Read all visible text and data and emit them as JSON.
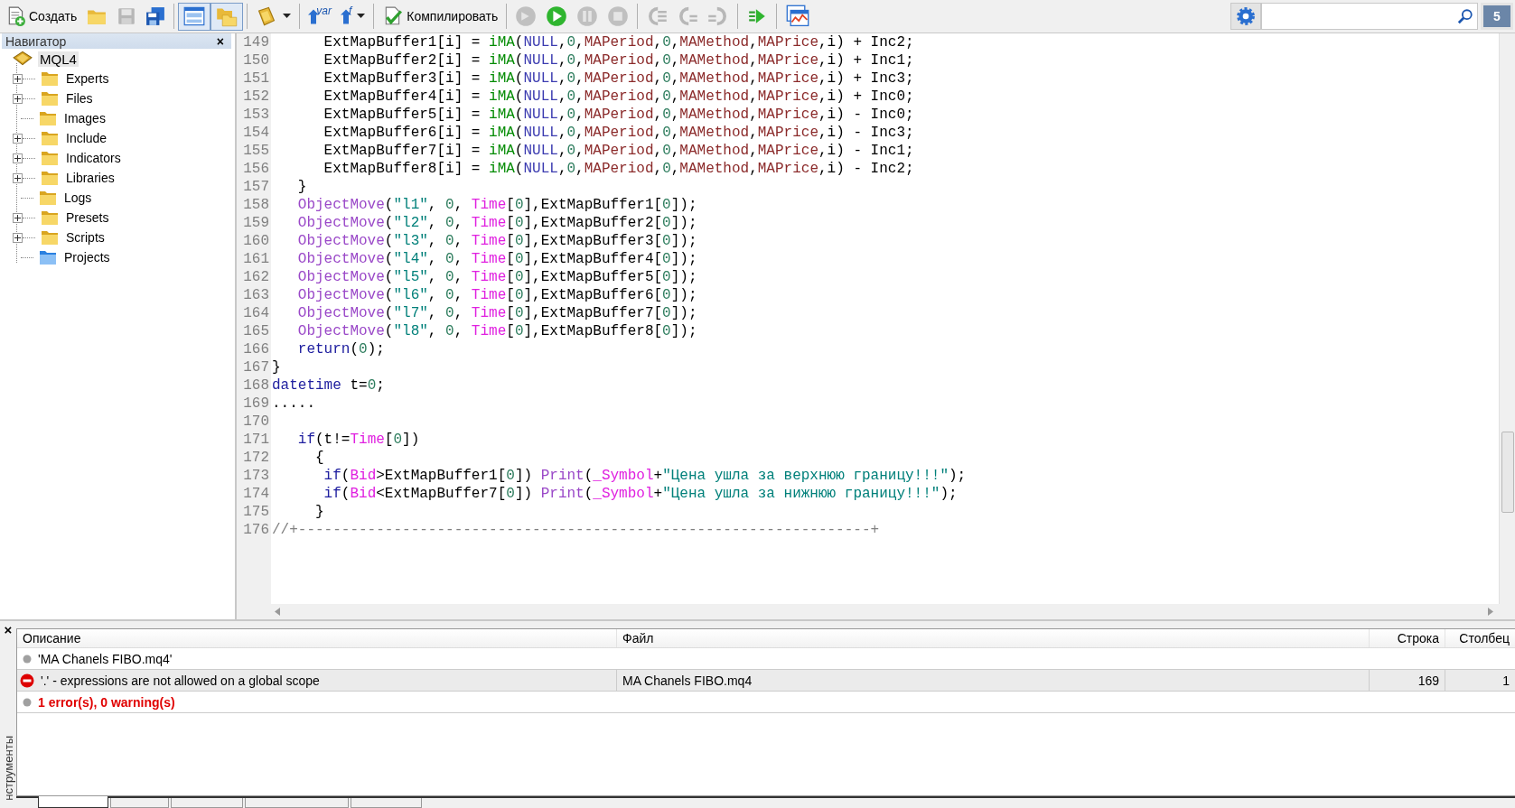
{
  "toolbar": {
    "items": [
      {
        "kind": "button",
        "label": "Создать",
        "pressed": false,
        "disabled": false
      },
      {
        "kind": "button",
        "pressed": false,
        "disabled": false
      },
      {
        "kind": "button",
        "pressed": false,
        "disabled": true
      },
      {
        "kind": "button",
        "pressed": false,
        "disabled": false
      },
      {
        "kind": "separator"
      },
      {
        "kind": "button",
        "pressed": true,
        "disabled": false
      },
      {
        "kind": "button",
        "pressed": true,
        "disabled": false
      },
      {
        "kind": "separator"
      },
      {
        "kind": "dropdown",
        "pressed": false,
        "disabled": false
      },
      {
        "kind": "separator"
      },
      {
        "kind": "button",
        "sup": "var",
        "pressed": false,
        "disabled": false
      },
      {
        "kind": "dropdown",
        "sup": "f",
        "pressed": false,
        "disabled": false
      },
      {
        "kind": "separator"
      },
      {
        "kind": "button",
        "label": "Компилировать",
        "pressed": false,
        "disabled": false
      },
      {
        "kind": "separator"
      },
      {
        "kind": "button",
        "pressed": false,
        "disabled": true
      },
      {
        "kind": "button",
        "pressed": false,
        "disabled": false
      },
      {
        "kind": "button",
        "pressed": false,
        "disabled": true
      },
      {
        "kind": "button",
        "pressed": false,
        "disabled": true
      },
      {
        "kind": "separator"
      },
      {
        "kind": "button",
        "pressed": false,
        "disabled": true
      },
      {
        "kind": "button",
        "pressed": false,
        "disabled": true
      },
      {
        "kind": "button",
        "pressed": false,
        "disabled": true
      },
      {
        "kind": "separator"
      },
      {
        "kind": "button",
        "pressed": false,
        "disabled": false
      },
      {
        "kind": "separator"
      },
      {
        "kind": "button",
        "pressed": false,
        "disabled": false
      }
    ],
    "messages_badge": "5"
  },
  "navigator": {
    "title": "Навигатор",
    "close": "×",
    "root": {
      "label": "MQL4",
      "selected": true,
      "children": [
        {
          "label": "Experts",
          "kind": "folder",
          "expandable": true,
          "selected": false
        },
        {
          "label": "Files",
          "kind": "folder",
          "expandable": true,
          "selected": false
        },
        {
          "label": "Images",
          "kind": "folder",
          "expandable": false,
          "selected": false
        },
        {
          "label": "Include",
          "kind": "folder",
          "expandable": true,
          "selected": false
        },
        {
          "label": "Indicators",
          "kind": "folder",
          "expandable": true,
          "selected": false
        },
        {
          "label": "Libraries",
          "kind": "folder",
          "expandable": true,
          "selected": false
        },
        {
          "label": "Logs",
          "kind": "folder",
          "expandable": false,
          "selected": false
        },
        {
          "label": "Presets",
          "kind": "folder",
          "expandable": true,
          "selected": false
        },
        {
          "label": "Scripts",
          "kind": "folder",
          "expandable": true,
          "selected": false
        },
        {
          "label": "Projects",
          "kind": "project",
          "expandable": false,
          "selected": false
        }
      ]
    }
  },
  "editor": {
    "lines": [
      {
        "number": "149",
        "tokens": [
          {
            "kind": "plain",
            "text": "      ExtMapBuffer1[i] = "
          },
          {
            "kind": "builtin",
            "text": "iMA"
          },
          {
            "kind": "plain",
            "text": "("
          },
          {
            "kind": "constant",
            "text": "NULL"
          },
          {
            "kind": "plain",
            "text": ","
          },
          {
            "kind": "number",
            "text": "0"
          },
          {
            "kind": "plain",
            "text": ","
          },
          {
            "kind": "input",
            "text": "MAPeriod"
          },
          {
            "kind": "plain",
            "text": ","
          },
          {
            "kind": "number",
            "text": "0"
          },
          {
            "kind": "plain",
            "text": ","
          },
          {
            "kind": "input",
            "text": "MAMethod"
          },
          {
            "kind": "plain",
            "text": ","
          },
          {
            "kind": "input",
            "text": "MAPrice"
          },
          {
            "kind": "plain",
            "text": ",i) + Inc2;"
          }
        ]
      },
      {
        "number": "150",
        "tokens": [
          {
            "kind": "plain",
            "text": "      ExtMapBuffer2[i] = "
          },
          {
            "kind": "builtin",
            "text": "iMA"
          },
          {
            "kind": "plain",
            "text": "("
          },
          {
            "kind": "constant",
            "text": "NULL"
          },
          {
            "kind": "plain",
            "text": ","
          },
          {
            "kind": "number",
            "text": "0"
          },
          {
            "kind": "plain",
            "text": ","
          },
          {
            "kind": "input",
            "text": "MAPeriod"
          },
          {
            "kind": "plain",
            "text": ","
          },
          {
            "kind": "number",
            "text": "0"
          },
          {
            "kind": "plain",
            "text": ","
          },
          {
            "kind": "input",
            "text": "MAMethod"
          },
          {
            "kind": "plain",
            "text": ","
          },
          {
            "kind": "input",
            "text": "MAPrice"
          },
          {
            "kind": "plain",
            "text": ",i) + Inc1;"
          }
        ]
      },
      {
        "number": "151",
        "tokens": [
          {
            "kind": "plain",
            "text": "      ExtMapBuffer3[i] = "
          },
          {
            "kind": "builtin",
            "text": "iMA"
          },
          {
            "kind": "plain",
            "text": "("
          },
          {
            "kind": "constant",
            "text": "NULL"
          },
          {
            "kind": "plain",
            "text": ","
          },
          {
            "kind": "number",
            "text": "0"
          },
          {
            "kind": "plain",
            "text": ","
          },
          {
            "kind": "input",
            "text": "MAPeriod"
          },
          {
            "kind": "plain",
            "text": ","
          },
          {
            "kind": "number",
            "text": "0"
          },
          {
            "kind": "plain",
            "text": ","
          },
          {
            "kind": "input",
            "text": "MAMethod"
          },
          {
            "kind": "plain",
            "text": ","
          },
          {
            "kind": "input",
            "text": "MAPrice"
          },
          {
            "kind": "plain",
            "text": ",i) + Inc3;"
          }
        ]
      },
      {
        "number": "152",
        "tokens": [
          {
            "kind": "plain",
            "text": "      ExtMapBuffer4[i] = "
          },
          {
            "kind": "builtin",
            "text": "iMA"
          },
          {
            "kind": "plain",
            "text": "("
          },
          {
            "kind": "constant",
            "text": "NULL"
          },
          {
            "kind": "plain",
            "text": ","
          },
          {
            "kind": "number",
            "text": "0"
          },
          {
            "kind": "plain",
            "text": ","
          },
          {
            "kind": "input",
            "text": "MAPeriod"
          },
          {
            "kind": "plain",
            "text": ","
          },
          {
            "kind": "number",
            "text": "0"
          },
          {
            "kind": "plain",
            "text": ","
          },
          {
            "kind": "input",
            "text": "MAMethod"
          },
          {
            "kind": "plain",
            "text": ","
          },
          {
            "kind": "input",
            "text": "MAPrice"
          },
          {
            "kind": "plain",
            "text": ",i) + Inc0;"
          }
        ]
      },
      {
        "number": "153",
        "tokens": [
          {
            "kind": "plain",
            "text": "      ExtMapBuffer5[i] = "
          },
          {
            "kind": "builtin",
            "text": "iMA"
          },
          {
            "kind": "plain",
            "text": "("
          },
          {
            "kind": "constant",
            "text": "NULL"
          },
          {
            "kind": "plain",
            "text": ","
          },
          {
            "kind": "number",
            "text": "0"
          },
          {
            "kind": "plain",
            "text": ","
          },
          {
            "kind": "input",
            "text": "MAPeriod"
          },
          {
            "kind": "plain",
            "text": ","
          },
          {
            "kind": "number",
            "text": "0"
          },
          {
            "kind": "plain",
            "text": ","
          },
          {
            "kind": "input",
            "text": "MAMethod"
          },
          {
            "kind": "plain",
            "text": ","
          },
          {
            "kind": "input",
            "text": "MAPrice"
          },
          {
            "kind": "plain",
            "text": ",i) - Inc0;"
          }
        ]
      },
      {
        "number": "154",
        "tokens": [
          {
            "kind": "plain",
            "text": "      ExtMapBuffer6[i] = "
          },
          {
            "kind": "builtin",
            "text": "iMA"
          },
          {
            "kind": "plain",
            "text": "("
          },
          {
            "kind": "constant",
            "text": "NULL"
          },
          {
            "kind": "plain",
            "text": ","
          },
          {
            "kind": "number",
            "text": "0"
          },
          {
            "kind": "plain",
            "text": ","
          },
          {
            "kind": "input",
            "text": "MAPeriod"
          },
          {
            "kind": "plain",
            "text": ","
          },
          {
            "kind": "number",
            "text": "0"
          },
          {
            "kind": "plain",
            "text": ","
          },
          {
            "kind": "input",
            "text": "MAMethod"
          },
          {
            "kind": "plain",
            "text": ","
          },
          {
            "kind": "input",
            "text": "MAPrice"
          },
          {
            "kind": "plain",
            "text": ",i) - Inc3;"
          }
        ]
      },
      {
        "number": "155",
        "tokens": [
          {
            "kind": "plain",
            "text": "      ExtMapBuffer7[i] = "
          },
          {
            "kind": "builtin",
            "text": "iMA"
          },
          {
            "kind": "plain",
            "text": "("
          },
          {
            "kind": "constant",
            "text": "NULL"
          },
          {
            "kind": "plain",
            "text": ","
          },
          {
            "kind": "number",
            "text": "0"
          },
          {
            "kind": "plain",
            "text": ","
          },
          {
            "kind": "input",
            "text": "MAPeriod"
          },
          {
            "kind": "plain",
            "text": ","
          },
          {
            "kind": "number",
            "text": "0"
          },
          {
            "kind": "plain",
            "text": ","
          },
          {
            "kind": "input",
            "text": "MAMethod"
          },
          {
            "kind": "plain",
            "text": ","
          },
          {
            "kind": "input",
            "text": "MAPrice"
          },
          {
            "kind": "plain",
            "text": ",i) - Inc1;"
          }
        ]
      },
      {
        "number": "156",
        "tokens": [
          {
            "kind": "plain",
            "text": "      ExtMapBuffer8[i] = "
          },
          {
            "kind": "builtin",
            "text": "iMA"
          },
          {
            "kind": "plain",
            "text": "("
          },
          {
            "kind": "constant",
            "text": "NULL"
          },
          {
            "kind": "plain",
            "text": ","
          },
          {
            "kind": "number",
            "text": "0"
          },
          {
            "kind": "plain",
            "text": ","
          },
          {
            "kind": "input",
            "text": "MAPeriod"
          },
          {
            "kind": "plain",
            "text": ","
          },
          {
            "kind": "number",
            "text": "0"
          },
          {
            "kind": "plain",
            "text": ","
          },
          {
            "kind": "input",
            "text": "MAMethod"
          },
          {
            "kind": "plain",
            "text": ","
          },
          {
            "kind": "input",
            "text": "MAPrice"
          },
          {
            "kind": "plain",
            "text": ",i) - Inc2;"
          }
        ]
      },
      {
        "number": "157",
        "tokens": [
          {
            "kind": "plain",
            "text": "   }"
          }
        ]
      },
      {
        "number": "158",
        "tokens": [
          {
            "kind": "function",
            "text": "   ObjectMove"
          },
          {
            "kind": "plain",
            "text": "("
          },
          {
            "kind": "string",
            "text": "\"l1\""
          },
          {
            "kind": "plain",
            "text": ", "
          },
          {
            "kind": "number",
            "text": "0"
          },
          {
            "kind": "plain",
            "text": ", "
          },
          {
            "kind": "variable",
            "text": "Time"
          },
          {
            "kind": "plain",
            "text": "["
          },
          {
            "kind": "number",
            "text": "0"
          },
          {
            "kind": "plain",
            "text": "],ExtMapBuffer1["
          },
          {
            "kind": "number",
            "text": "0"
          },
          {
            "kind": "plain",
            "text": "]);"
          }
        ]
      },
      {
        "number": "159",
        "tokens": [
          {
            "kind": "function",
            "text": "   ObjectMove"
          },
          {
            "kind": "plain",
            "text": "("
          },
          {
            "kind": "string",
            "text": "\"l2\""
          },
          {
            "kind": "plain",
            "text": ", "
          },
          {
            "kind": "number",
            "text": "0"
          },
          {
            "kind": "plain",
            "text": ", "
          },
          {
            "kind": "variable",
            "text": "Time"
          },
          {
            "kind": "plain",
            "text": "["
          },
          {
            "kind": "number",
            "text": "0"
          },
          {
            "kind": "plain",
            "text": "],ExtMapBuffer2["
          },
          {
            "kind": "number",
            "text": "0"
          },
          {
            "kind": "plain",
            "text": "]);"
          }
        ]
      },
      {
        "number": "160",
        "tokens": [
          {
            "kind": "function",
            "text": "   ObjectMove"
          },
          {
            "kind": "plain",
            "text": "("
          },
          {
            "kind": "string",
            "text": "\"l3\""
          },
          {
            "kind": "plain",
            "text": ", "
          },
          {
            "kind": "number",
            "text": "0"
          },
          {
            "kind": "plain",
            "text": ", "
          },
          {
            "kind": "variable",
            "text": "Time"
          },
          {
            "kind": "plain",
            "text": "["
          },
          {
            "kind": "number",
            "text": "0"
          },
          {
            "kind": "plain",
            "text": "],ExtMapBuffer3["
          },
          {
            "kind": "number",
            "text": "0"
          },
          {
            "kind": "plain",
            "text": "]);"
          }
        ]
      },
      {
        "number": "161",
        "tokens": [
          {
            "kind": "function",
            "text": "   ObjectMove"
          },
          {
            "kind": "plain",
            "text": "("
          },
          {
            "kind": "string",
            "text": "\"l4\""
          },
          {
            "kind": "plain",
            "text": ", "
          },
          {
            "kind": "number",
            "text": "0"
          },
          {
            "kind": "plain",
            "text": ", "
          },
          {
            "kind": "variable",
            "text": "Time"
          },
          {
            "kind": "plain",
            "text": "["
          },
          {
            "kind": "number",
            "text": "0"
          },
          {
            "kind": "plain",
            "text": "],ExtMapBuffer4["
          },
          {
            "kind": "number",
            "text": "0"
          },
          {
            "kind": "plain",
            "text": "]);"
          }
        ]
      },
      {
        "number": "162",
        "tokens": [
          {
            "kind": "function",
            "text": "   ObjectMove"
          },
          {
            "kind": "plain",
            "text": "("
          },
          {
            "kind": "string",
            "text": "\"l5\""
          },
          {
            "kind": "plain",
            "text": ", "
          },
          {
            "kind": "number",
            "text": "0"
          },
          {
            "kind": "plain",
            "text": ", "
          },
          {
            "kind": "variable",
            "text": "Time"
          },
          {
            "kind": "plain",
            "text": "["
          },
          {
            "kind": "number",
            "text": "0"
          },
          {
            "kind": "plain",
            "text": "],ExtMapBuffer5["
          },
          {
            "kind": "number",
            "text": "0"
          },
          {
            "kind": "plain",
            "text": "]);"
          }
        ]
      },
      {
        "number": "163",
        "tokens": [
          {
            "kind": "function",
            "text": "   ObjectMove"
          },
          {
            "kind": "plain",
            "text": "("
          },
          {
            "kind": "string",
            "text": "\"l6\""
          },
          {
            "kind": "plain",
            "text": ", "
          },
          {
            "kind": "number",
            "text": "0"
          },
          {
            "kind": "plain",
            "text": ", "
          },
          {
            "kind": "variable",
            "text": "Time"
          },
          {
            "kind": "plain",
            "text": "["
          },
          {
            "kind": "number",
            "text": "0"
          },
          {
            "kind": "plain",
            "text": "],ExtMapBuffer6["
          },
          {
            "kind": "number",
            "text": "0"
          },
          {
            "kind": "plain",
            "text": "]);"
          }
        ]
      },
      {
        "number": "164",
        "tokens": [
          {
            "kind": "function",
            "text": "   ObjectMove"
          },
          {
            "kind": "plain",
            "text": "("
          },
          {
            "kind": "string",
            "text": "\"l7\""
          },
          {
            "kind": "plain",
            "text": ", "
          },
          {
            "kind": "number",
            "text": "0"
          },
          {
            "kind": "plain",
            "text": ", "
          },
          {
            "kind": "variable",
            "text": "Time"
          },
          {
            "kind": "plain",
            "text": "["
          },
          {
            "kind": "number",
            "text": "0"
          },
          {
            "kind": "plain",
            "text": "],ExtMapBuffer7["
          },
          {
            "kind": "number",
            "text": "0"
          },
          {
            "kind": "plain",
            "text": "]);"
          }
        ]
      },
      {
        "number": "165",
        "tokens": [
          {
            "kind": "function",
            "text": "   ObjectMove"
          },
          {
            "kind": "plain",
            "text": "("
          },
          {
            "kind": "string",
            "text": "\"l8\""
          },
          {
            "kind": "plain",
            "text": ", "
          },
          {
            "kind": "number",
            "text": "0"
          },
          {
            "kind": "plain",
            "text": ", "
          },
          {
            "kind": "variable",
            "text": "Time"
          },
          {
            "kind": "plain",
            "text": "["
          },
          {
            "kind": "number",
            "text": "0"
          },
          {
            "kind": "plain",
            "text": "],ExtMapBuffer8["
          },
          {
            "kind": "number",
            "text": "0"
          },
          {
            "kind": "plain",
            "text": "]);"
          }
        ]
      },
      {
        "number": "166",
        "tokens": [
          {
            "kind": "keyword",
            "text": "   return"
          },
          {
            "kind": "plain",
            "text": "("
          },
          {
            "kind": "number",
            "text": "0"
          },
          {
            "kind": "plain",
            "text": ");"
          }
        ]
      },
      {
        "number": "167",
        "tokens": [
          {
            "kind": "plain",
            "text": "}"
          }
        ]
      },
      {
        "number": "168",
        "tokens": [
          {
            "kind": "keyword",
            "text": "datetime"
          },
          {
            "kind": "plain",
            "text": " t="
          },
          {
            "kind": "number",
            "text": "0"
          },
          {
            "kind": "plain",
            "text": ";"
          }
        ]
      },
      {
        "number": "169",
        "tokens": [
          {
            "kind": "plain",
            "text": "....."
          }
        ]
      },
      {
        "number": "170"
      },
      {
        "number": "171",
        "tokens": [
          {
            "kind": "keyword",
            "text": "   if"
          },
          {
            "kind": "plain",
            "text": "(t!="
          },
          {
            "kind": "variable",
            "text": "Time"
          },
          {
            "kind": "plain",
            "text": "["
          },
          {
            "kind": "number",
            "text": "0"
          },
          {
            "kind": "plain",
            "text": "])"
          }
        ]
      },
      {
        "number": "172",
        "tokens": [
          {
            "kind": "plain",
            "text": "     {"
          }
        ]
      },
      {
        "number": "173",
        "tokens": [
          {
            "kind": "keyword",
            "text": "      if"
          },
          {
            "kind": "plain",
            "text": "("
          },
          {
            "kind": "variable",
            "text": "Bid"
          },
          {
            "kind": "plain",
            "text": ">ExtMapBuffer1["
          },
          {
            "kind": "number",
            "text": "0"
          },
          {
            "kind": "plain",
            "text": "]) "
          },
          {
            "kind": "function",
            "text": "Print"
          },
          {
            "kind": "plain",
            "text": "("
          },
          {
            "kind": "variable",
            "text": "_Symbol"
          },
          {
            "kind": "plain",
            "text": "+"
          },
          {
            "kind": "string",
            "text": "\"Цена ушла за верхнюю границу!!!\""
          },
          {
            "kind": "plain",
            "text": ");"
          }
        ]
      },
      {
        "number": "174",
        "tokens": [
          {
            "kind": "keyword",
            "text": "      if"
          },
          {
            "kind": "plain",
            "text": "("
          },
          {
            "kind": "variable",
            "text": "Bid"
          },
          {
            "kind": "plain",
            "text": "<ExtMapBuffer7["
          },
          {
            "kind": "number",
            "text": "0"
          },
          {
            "kind": "plain",
            "text": "]) "
          },
          {
            "kind": "function",
            "text": "Print"
          },
          {
            "kind": "plain",
            "text": "("
          },
          {
            "kind": "variable",
            "text": "_Symbol"
          },
          {
            "kind": "plain",
            "text": "+"
          },
          {
            "kind": "string",
            "text": "\"Цена ушла за нижнюю границу!!!\""
          },
          {
            "kind": "plain",
            "text": ");"
          }
        ]
      },
      {
        "number": "175",
        "tokens": [
          {
            "kind": "plain",
            "text": "     }"
          }
        ]
      },
      {
        "number": "176",
        "tokens": [
          {
            "kind": "comment",
            "text": "//+------------------------------------------------------------------+"
          }
        ]
      }
    ]
  },
  "toolbox": {
    "side_label": "нструменты",
    "close": "×",
    "columns": [
      "Описание",
      "Файл",
      "Строка",
      "Столбец"
    ],
    "rows": [
      {
        "kind": "info",
        "description": "'MA Chanels FIBO.mq4'",
        "selected": false
      },
      {
        "kind": "error",
        "description": "'.' - expressions are not allowed on a global scope",
        "file": "MA Chanels FIBO.mq4",
        "line": "169",
        "column": "1",
        "selected": true
      },
      {
        "kind": "summary",
        "description": "1 error(s), 0 warning(s)",
        "selected": false
      }
    ],
    "tabs": [
      {
        "selected": true
      },
      {
        "selected": false
      },
      {
        "selected": false
      },
      {
        "selected": false
      },
      {
        "selected": false
      }
    ]
  }
}
